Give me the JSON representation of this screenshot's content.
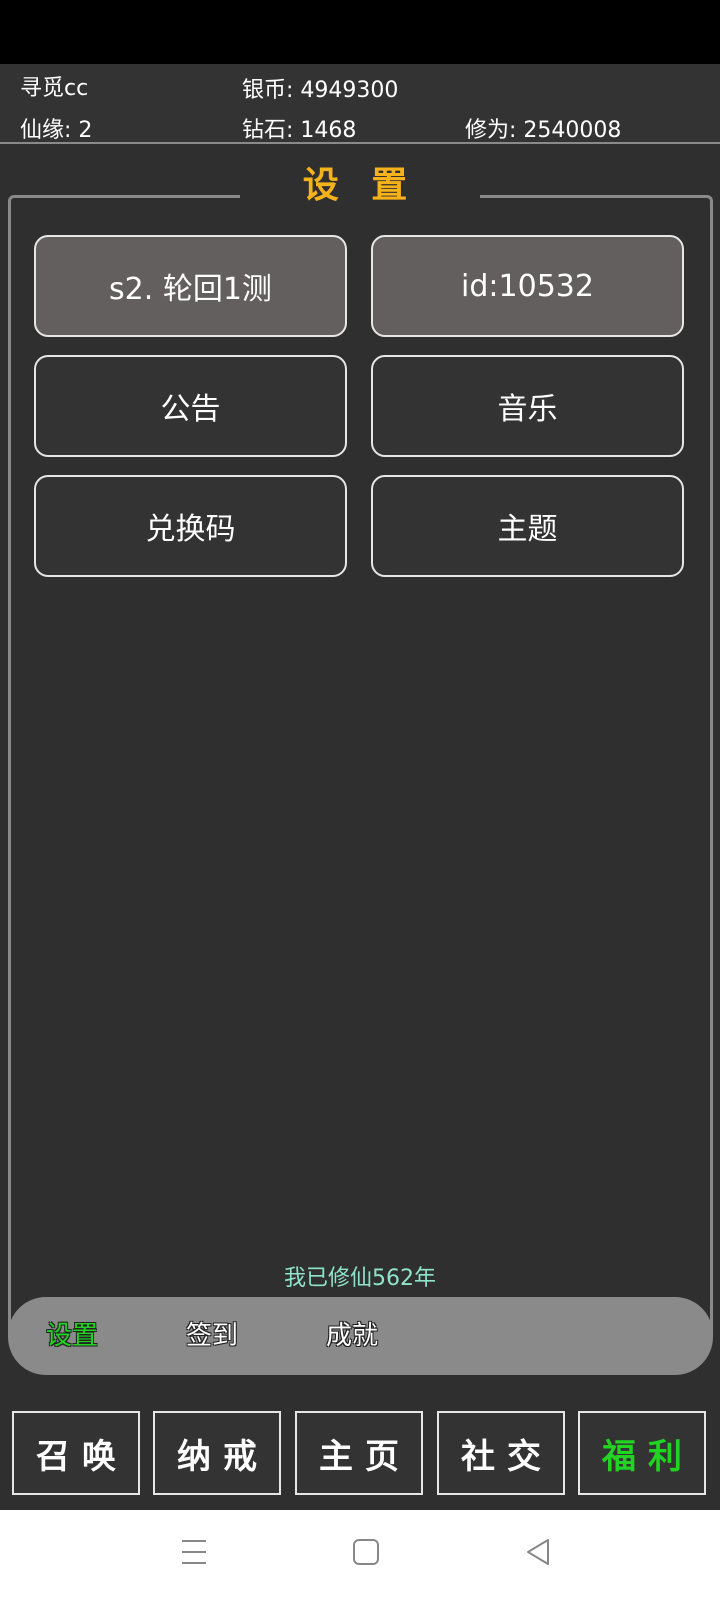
{
  "player": {
    "name": "寻觅cc",
    "silver": "银币: 4949300",
    "fate": "仙缘: 2",
    "diamond": "钻石: 1468",
    "cultivation": "修为: 2540008"
  },
  "panel": {
    "title": "设 置",
    "buttons": [
      "s2. 轮回1测",
      "id:10532",
      "公告",
      "音乐",
      "兑换码",
      "主题"
    ],
    "years_text": "我已修仙562年"
  },
  "subtabs": {
    "items": [
      "设置",
      "签到",
      "成就"
    ],
    "active": "设置"
  },
  "bottom_nav": {
    "items": [
      "召唤",
      "纳戒",
      "主页",
      "社交",
      "福利"
    ],
    "active": "福利"
  },
  "system_nav": {
    "icons": [
      "menu-icon",
      "home-icon",
      "back-icon"
    ]
  },
  "colors": {
    "title": "#f6b21b",
    "active_green": "#22d322",
    "years_text": "#8ee3c8",
    "background": "#2f2f2f"
  }
}
